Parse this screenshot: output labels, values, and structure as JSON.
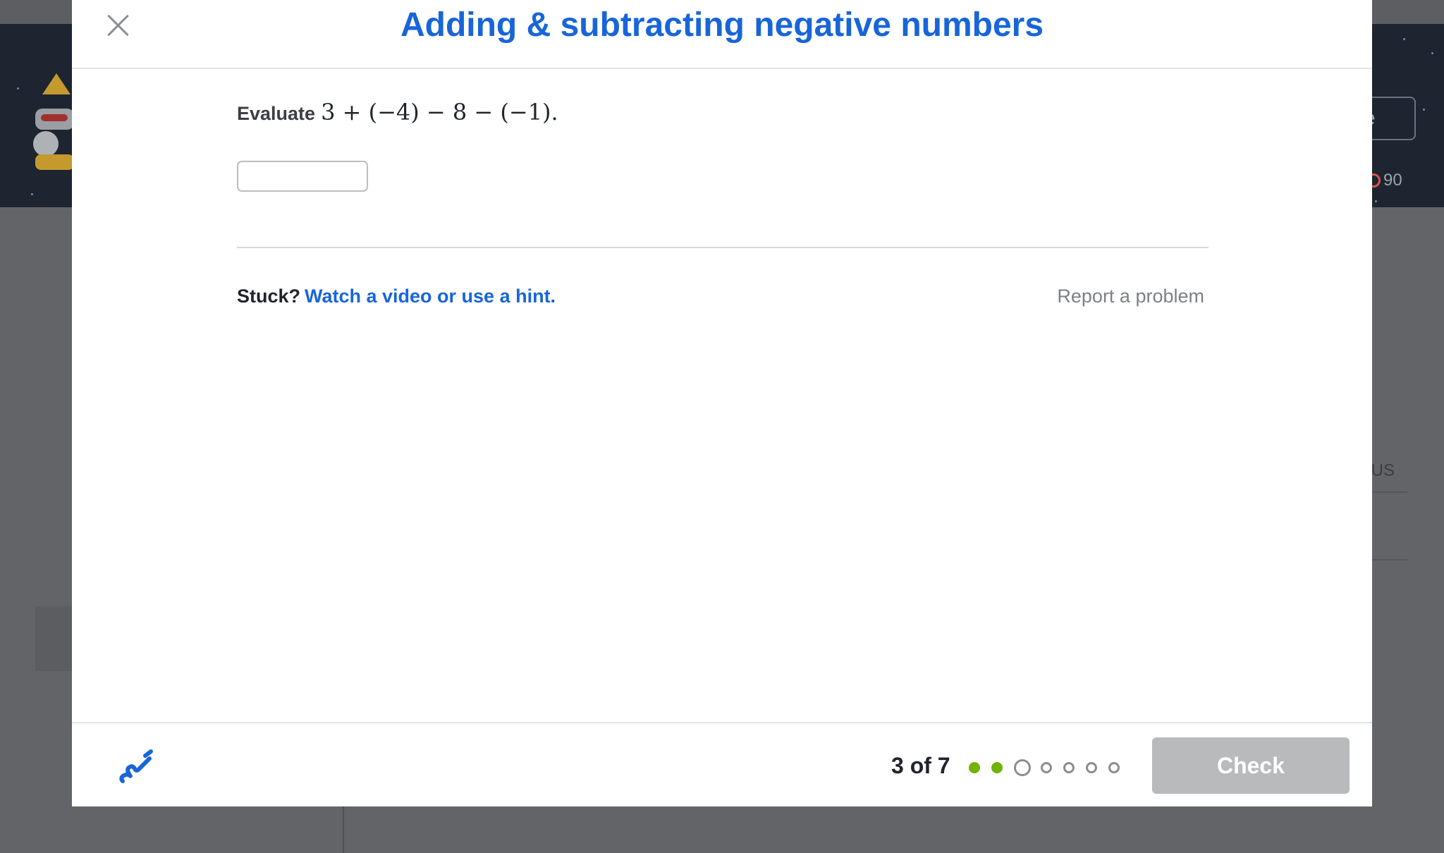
{
  "background": {
    "hero_button_fragment": "e",
    "points_value": "90",
    "status_fragment": "TUS"
  },
  "modal": {
    "title": "Adding & subtracting negative numbers",
    "question": {
      "prefix": "Evaluate",
      "expression": "3 + (−4) − 8 − (−1)."
    },
    "answer": {
      "value": "",
      "placeholder": ""
    },
    "help": {
      "stuck_label": "Stuck?",
      "hint_link": "Watch a video or use a hint.",
      "report_link": "Report a problem"
    },
    "footer": {
      "progress_label": "3 of 7",
      "progress": {
        "current": 3,
        "total": 7,
        "completed": 2
      },
      "check_label": "Check",
      "check_enabled": false
    }
  },
  "colors": {
    "accent": "#1865d9",
    "success_dot": "#71b307",
    "disabled_button": "#b9babc",
    "overlay": "#636468"
  },
  "icons": [
    "close-icon",
    "scratchpad-icon",
    "progress-dot"
  ]
}
